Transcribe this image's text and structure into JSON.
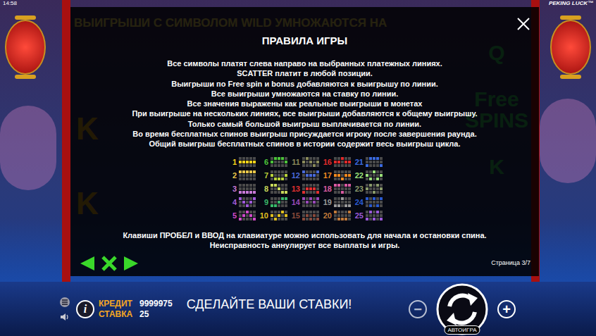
{
  "status": {
    "time": "14:58",
    "game_title": "PEKING LUCK™"
  },
  "banner": "ВЫИГРЫШИ С СИМВОЛОМ WILD УМНОЖАЮТСЯ НА",
  "reels": {
    "left": [
      "K",
      "K"
    ],
    "right": [
      "Q",
      "Free SPINS",
      "K"
    ]
  },
  "dialog": {
    "title": "ПРАВИЛА ИГРЫ",
    "rules": [
      "Все символы платят слева направо на выбранных платежных линиях.",
      "SCATTER платит в любой позиции.",
      "Выигрыши по Free spin и bonus добавляются к выигрышу по линии.",
      "Все выигрыши умножаются на ставку по линии.",
      "Все значения выражены как реальные выигрыши в монетах",
      "При выигрыше на нескольких линиях, все выигрыши добавляются к общему выигрышу.",
      "Только самый большой выигрыш выплачивается по линии.",
      "Во время бесплатных спинов выигрыш присуждается игроку после завершения раунда.",
      "Общий выигрыш бесплатных спинов в истории содержит весь выигрыш цикла."
    ],
    "paylines": [
      {
        "number": "1",
        "color": "#f2d21b",
        "rows": [
          1,
          1,
          1,
          1,
          1
        ]
      },
      {
        "number": "2",
        "color": "#e8c64a",
        "rows": [
          0,
          0,
          0,
          0,
          0
        ]
      },
      {
        "number": "3",
        "color": "#c77ad6",
        "rows": [
          2,
          2,
          2,
          2,
          2
        ]
      },
      {
        "number": "4",
        "color": "#a05ad8",
        "rows": [
          0,
          1,
          2,
          1,
          0
        ]
      },
      {
        "number": "5",
        "color": "#d04ac8",
        "rows": [
          2,
          1,
          0,
          1,
          2
        ]
      },
      {
        "number": "6",
        "color": "#4cc23a",
        "rows": [
          1,
          0,
          0,
          0,
          1
        ]
      },
      {
        "number": "7",
        "color": "#b8d23a",
        "rows": [
          1,
          2,
          2,
          2,
          1
        ]
      },
      {
        "number": "8",
        "color": "#c8d85a",
        "rows": [
          0,
          0,
          1,
          2,
          2
        ]
      },
      {
        "number": "9",
        "color": "#3ab86a",
        "rows": [
          2,
          2,
          1,
          0,
          0
        ]
      },
      {
        "number": "10",
        "color": "#e0c020",
        "rows": [
          1,
          2,
          1,
          0,
          1
        ]
      },
      {
        "number": "11",
        "color": "#8a8a5a",
        "rows": [
          1,
          0,
          1,
          2,
          1
        ]
      },
      {
        "number": "12",
        "color": "#4a6ad8",
        "rows": [
          0,
          1,
          1,
          1,
          0
        ]
      },
      {
        "number": "13",
        "color": "#e03030",
        "rows": [
          2,
          1,
          1,
          1,
          2
        ]
      },
      {
        "number": "14",
        "color": "#9a4ab8",
        "rows": [
          0,
          1,
          0,
          1,
          0
        ]
      },
      {
        "number": "15",
        "color": "#8a4a3a",
        "rows": [
          2,
          1,
          2,
          1,
          2
        ]
      },
      {
        "number": "16",
        "color": "#e02a2a",
        "rows": [
          1,
          1,
          0,
          1,
          1
        ]
      },
      {
        "number": "17",
        "color": "#f08a20",
        "rows": [
          1,
          1,
          2,
          1,
          1
        ]
      },
      {
        "number": "18",
        "color": "#d85aa0",
        "rows": [
          0,
          0,
          2,
          0,
          0
        ]
      },
      {
        "number": "19",
        "color": "#9a9a9a",
        "rows": [
          2,
          2,
          0,
          2,
          2
        ]
      },
      {
        "number": "20",
        "color": "#c07a3a",
        "rows": [
          0,
          2,
          2,
          2,
          0
        ]
      },
      {
        "number": "21",
        "color": "#3a6ae0",
        "rows": [
          2,
          0,
          0,
          0,
          2
        ]
      },
      {
        "number": "22",
        "color": "#9ae07a",
        "rows": [
          1,
          2,
          0,
          2,
          1
        ]
      },
      {
        "number": "23",
        "color": "#8a9a6a",
        "rows": [
          1,
          0,
          2,
          0,
          1
        ]
      },
      {
        "number": "24",
        "color": "#2a5ad0",
        "rows": [
          0,
          2,
          0,
          2,
          0
        ]
      },
      {
        "number": "25",
        "color": "#9a5ad8",
        "rows": [
          2,
          0,
          2,
          0,
          2
        ]
      }
    ],
    "notes": [
      "Клавиши ПРОБЕЛ и ВВОД на клавиатуре можно использовать для начала и остановки спина.",
      "Неисправность аннулирует все выплаты и игры."
    ],
    "page": "Страница 3/7"
  },
  "bottom_bar": {
    "info": "i",
    "credit_label": "КРЕДИТ",
    "credit": "9999975",
    "bet_label": "СТАВКА",
    "bet": "25",
    "message": "СДЕЛАЙТЕ ВАШИ СТАВКИ!",
    "minus": "−",
    "plus": "+",
    "autoplay": "АВТОИГРА"
  }
}
